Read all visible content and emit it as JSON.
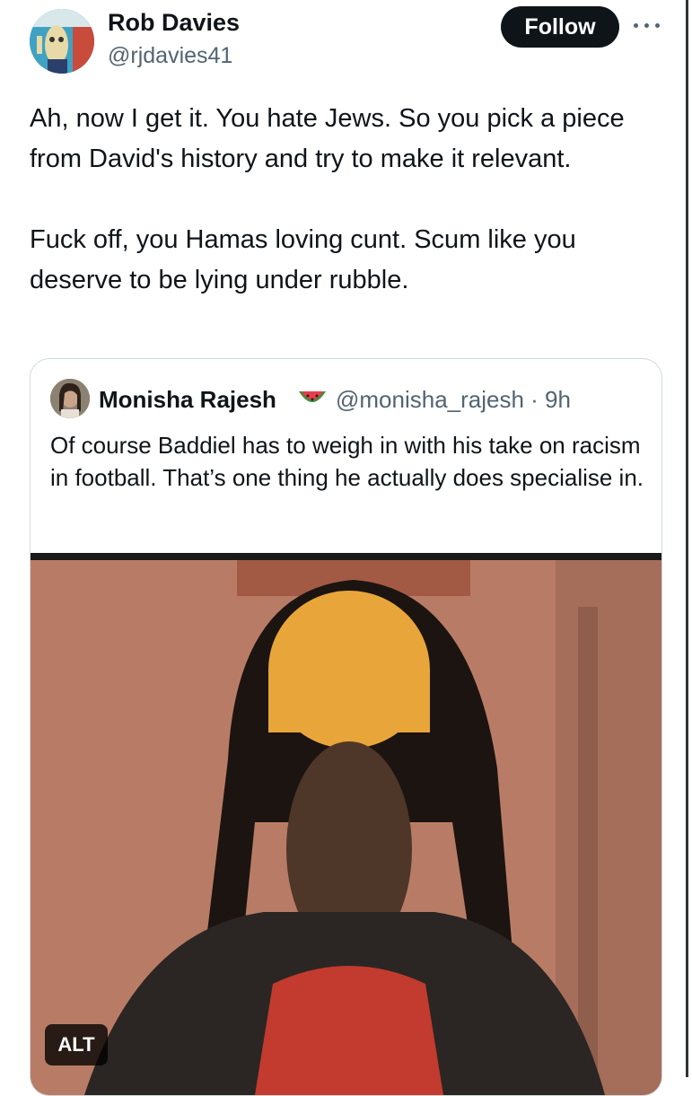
{
  "author": {
    "name": "Rob Davies",
    "handle": "@rjdavies41",
    "avatar_icon": "cartoon-avatar"
  },
  "actions": {
    "follow_label": "Follow",
    "more_icon": "more-dots-icon"
  },
  "tweet": {
    "text": "Ah, now I get it. You hate Jews. So you pick a piece from David's history and try to make it relevant.\n\nFuck off, you Hamas loving cunt. Scum like you deserve to be lying under rubble."
  },
  "quoted_tweet": {
    "name": "Monisha Rajesh",
    "emoji_icon": "watermelon-icon",
    "handle_time": "@monisha_rajesh · 9h",
    "text": "Of course Baddiel has to weigh in with his take on racism in football. That’s one thing he actually does specialise in.",
    "media": {
      "alt_label": "ALT"
    }
  },
  "colors": {
    "text_primary": "#0f1419",
    "text_secondary": "#536471",
    "border": "#cfd9de",
    "follow_bg": "#0f1419"
  }
}
